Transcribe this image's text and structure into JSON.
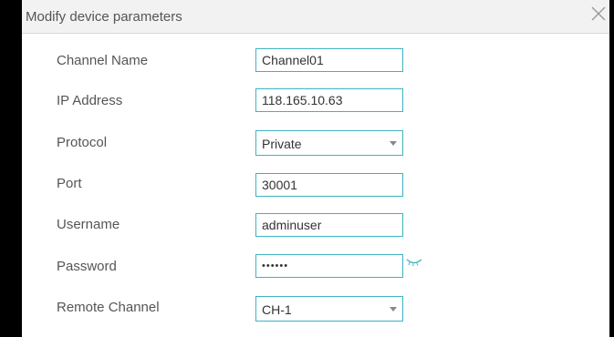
{
  "dialog": {
    "title": "Modify device parameters",
    "close_icon": "close-icon"
  },
  "form": {
    "channel_name": {
      "label": "Channel Name",
      "value": "Channel01"
    },
    "ip_address": {
      "label": "IP Address",
      "value": "118.165.10.63"
    },
    "protocol": {
      "label": "Protocol",
      "value": "Private"
    },
    "port": {
      "label": "Port",
      "value": "30001"
    },
    "username": {
      "label": "Username",
      "value": "adminuser"
    },
    "password": {
      "label": "Password",
      "value": "••••••",
      "toggle_icon": "eye-closed-icon"
    },
    "remote_channel": {
      "label": "Remote Channel",
      "value": "CH-1"
    }
  },
  "colors": {
    "field_border": "#3fb3c2",
    "title_bar": "#f2f2f2",
    "label_text": "#555555"
  }
}
